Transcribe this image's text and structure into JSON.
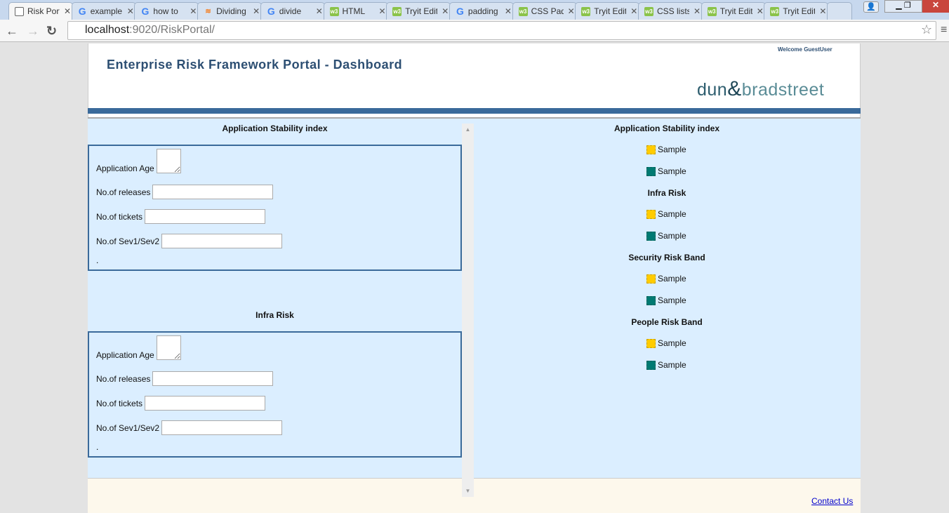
{
  "browser": {
    "tabs": [
      {
        "title": "Risk Portal",
        "icon": "doc"
      },
      {
        "title": "example",
        "icon": "google"
      },
      {
        "title": "how to",
        "icon": "google"
      },
      {
        "title": "Dividing",
        "icon": "stackoverflow"
      },
      {
        "title": "divide",
        "icon": "google"
      },
      {
        "title": "HTML",
        "icon": "w3"
      },
      {
        "title": "Tryit Editor",
        "icon": "w3"
      },
      {
        "title": "padding",
        "icon": "google"
      },
      {
        "title": "CSS Padding",
        "icon": "w3"
      },
      {
        "title": "Tryit Editor",
        "icon": "w3"
      },
      {
        "title": "CSS lists",
        "icon": "w3"
      },
      {
        "title": "Tryit Editor",
        "icon": "w3"
      },
      {
        "title": "Tryit Editor",
        "icon": "w3"
      }
    ],
    "url_host": "localhost",
    "url_rest": ":9020/RiskPortal/"
  },
  "header": {
    "title": "Enterprise Risk Framework Portal - Dashboard",
    "welcome": "Welcome GuestUser",
    "logo_left": "dun",
    "logo_amp": "&",
    "logo_right": "bradstreet"
  },
  "left": {
    "sections": [
      {
        "title": "Application Stability index",
        "fields": [
          {
            "label": "Application Age",
            "value": ""
          },
          {
            "label": "No.of releases",
            "value": ""
          },
          {
            "label": "No.of tickets",
            "value": ""
          },
          {
            "label": "No.of Sev1/Sev2",
            "value": ""
          }
        ],
        "trailer": "."
      },
      {
        "title": "Infra Risk",
        "fields": [
          {
            "label": "Application Age",
            "value": ""
          },
          {
            "label": "No.of releases",
            "value": ""
          },
          {
            "label": "No.of tickets",
            "value": ""
          },
          {
            "label": "No.of Sev1/Sev2",
            "value": ""
          }
        ],
        "trailer": "."
      }
    ]
  },
  "right": {
    "groups": [
      {
        "title": "Application Stability index",
        "items": [
          {
            "label": "Sample",
            "color": "#ffcc00"
          },
          {
            "label": "Sample",
            "color": "#007a72"
          }
        ]
      },
      {
        "title": "Infra Risk",
        "items": [
          {
            "label": "Sample",
            "color": "#ffcc00"
          },
          {
            "label": "Sample",
            "color": "#007a72"
          }
        ]
      },
      {
        "title": "Security Risk Band",
        "items": [
          {
            "label": "Sample",
            "color": "#ffcc00"
          },
          {
            "label": "Sample",
            "color": "#007a72"
          }
        ]
      },
      {
        "title": "People Risk Band",
        "items": [
          {
            "label": "Sample",
            "color": "#ffcc00"
          },
          {
            "label": "Sample",
            "color": "#007a72"
          }
        ]
      }
    ]
  },
  "footer": {
    "contact": "Contact Us"
  }
}
